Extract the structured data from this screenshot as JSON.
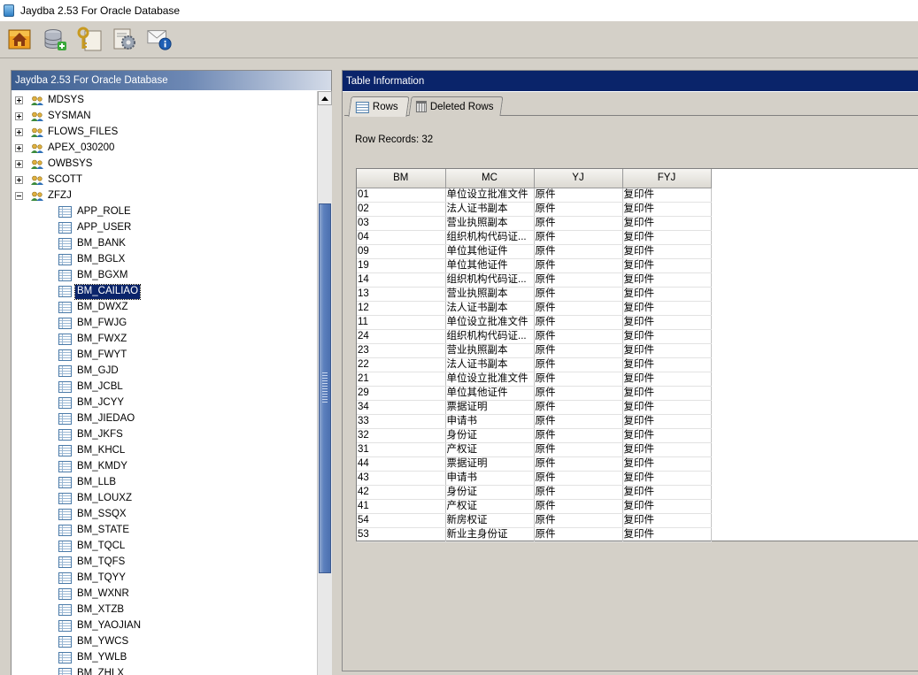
{
  "window": {
    "title": "Jaydba 2.53 For Oracle Database"
  },
  "toolbar": {
    "buttons": [
      {
        "name": "home-button",
        "icon": "home-icon"
      },
      {
        "name": "add-database-button",
        "icon": "database-add-icon"
      },
      {
        "name": "key-button",
        "icon": "key-icon"
      },
      {
        "name": "settings-button",
        "icon": "gear-icon"
      },
      {
        "name": "mail-info-button",
        "icon": "mail-info-icon"
      }
    ]
  },
  "tree": {
    "header": "Jaydba 2.53 For Oracle Database",
    "schemas": [
      {
        "label": "MDSYS",
        "expanded": false
      },
      {
        "label": "SYSMAN",
        "expanded": false
      },
      {
        "label": "FLOWS_FILES",
        "expanded": false
      },
      {
        "label": "APEX_030200",
        "expanded": false
      },
      {
        "label": "OWBSYS",
        "expanded": false
      },
      {
        "label": "SCOTT",
        "expanded": false
      },
      {
        "label": "ZFZJ",
        "expanded": true
      }
    ],
    "tables": [
      "APP_ROLE",
      "APP_USER",
      "BM_BANK",
      "BM_BGLX",
      "BM_BGXM",
      "BM_CAILIAO",
      "BM_DWXZ",
      "BM_FWJG",
      "BM_FWXZ",
      "BM_FWYT",
      "BM_GJD",
      "BM_JCBL",
      "BM_JCYY",
      "BM_JIEDAO",
      "BM_JKFS",
      "BM_KHCL",
      "BM_KMDY",
      "BM_LLB",
      "BM_LOUXZ",
      "BM_SSQX",
      "BM_STATE",
      "BM_TQCL",
      "BM_TQFS",
      "BM_TQYY",
      "BM_WXNR",
      "BM_XTZB",
      "BM_YAOJIAN",
      "BM_YWCS",
      "BM_YWLB",
      "BM_ZHLX"
    ],
    "selected_table": "BM_CAILIAO"
  },
  "right": {
    "header": "Table Information",
    "tabs": {
      "rows": "Rows",
      "deleted_rows": "Deleted Rows"
    },
    "row_records": "Row Records: 32",
    "columns": [
      "BM",
      "MC",
      "YJ",
      "FYJ"
    ],
    "rows": [
      [
        "01",
        "单位设立批准文件",
        "原件",
        "复印件"
      ],
      [
        "02",
        "法人证书副本",
        "原件",
        "复印件"
      ],
      [
        "03",
        "营业执照副本",
        "原件",
        "复印件"
      ],
      [
        "04",
        "组织机构代码证...",
        "原件",
        "复印件"
      ],
      [
        "09",
        "单位其他证件",
        "原件",
        "复印件"
      ],
      [
        "19",
        "单位其他证件",
        "原件",
        "复印件"
      ],
      [
        "14",
        "组织机构代码证...",
        "原件",
        "复印件"
      ],
      [
        "13",
        "营业执照副本",
        "原件",
        "复印件"
      ],
      [
        "12",
        "法人证书副本",
        "原件",
        "复印件"
      ],
      [
        "11",
        "单位设立批准文件",
        "原件",
        "复印件"
      ],
      [
        "24",
        "组织机构代码证...",
        "原件",
        "复印件"
      ],
      [
        "23",
        "营业执照副本",
        "原件",
        "复印件"
      ],
      [
        "22",
        "法人证书副本",
        "原件",
        "复印件"
      ],
      [
        "21",
        "单位设立批准文件",
        "原件",
        "复印件"
      ],
      [
        "29",
        "单位其他证件",
        "原件",
        "复印件"
      ],
      [
        "34",
        "票据证明",
        "原件",
        "复印件"
      ],
      [
        "33",
        "申请书",
        "原件",
        "复印件"
      ],
      [
        "32",
        "身份证",
        "原件",
        "复印件"
      ],
      [
        "31",
        "产权证",
        "原件",
        "复印件"
      ],
      [
        "44",
        "票据证明",
        "原件",
        "复印件"
      ],
      [
        "43",
        "申请书",
        "原件",
        "复印件"
      ],
      [
        "42",
        "身份证",
        "原件",
        "复印件"
      ],
      [
        "41",
        "产权证",
        "原件",
        "复印件"
      ],
      [
        "54",
        "新房权证",
        "原件",
        "复印件"
      ],
      [
        "53",
        "新业主身份证",
        "原件",
        "复印件"
      ]
    ]
  },
  "colors": {
    "window_bg": "#d4d0c8",
    "header_dark": "#0a246a",
    "selection": "#0a246a",
    "scroll_thumb": "#5b7fbd"
  }
}
